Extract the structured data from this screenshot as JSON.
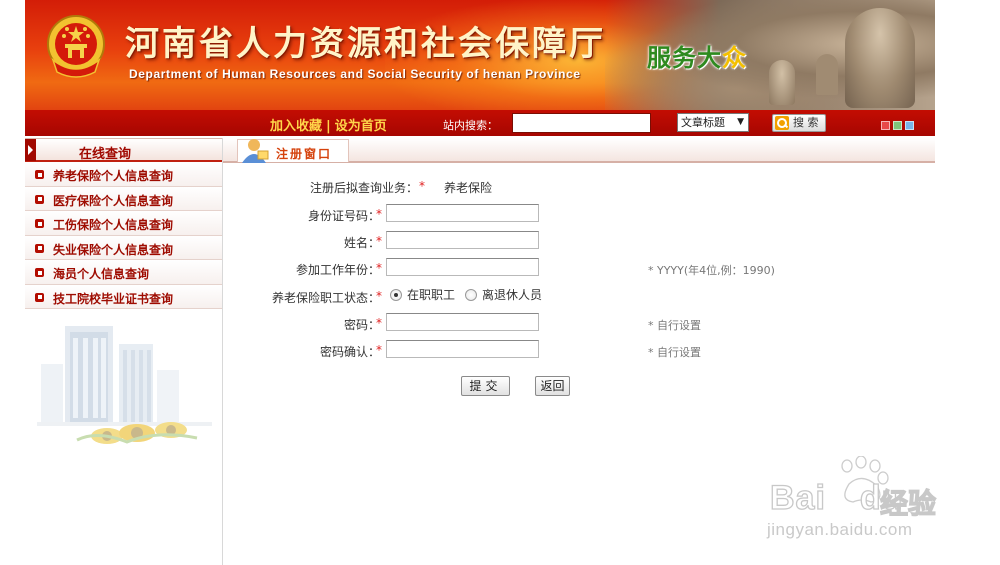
{
  "header": {
    "title": "河南省人力资源和社会保障厅",
    "subtitle": "Department of Human Resources and Social Security of henan Province",
    "slogan_main": "服务大",
    "slogan_last": "众"
  },
  "nav": {
    "bookmark": "加入收藏",
    "separator": "|",
    "homepage": "设为首页",
    "search_label": "站内搜索：",
    "search_value": "",
    "search_type": "文章标题",
    "search_type_arrow": "▼",
    "search_button": "搜 索",
    "swatch_colors": [
      "#e84848",
      "#7fc47a",
      "#7ab4e8"
    ]
  },
  "sidebar": {
    "title": "在线查询",
    "items": [
      {
        "label": "养老保险个人信息查询"
      },
      {
        "label": "医疗保险个人信息查询"
      },
      {
        "label": "工伤保险个人信息查询"
      },
      {
        "label": "失业保险个人信息查询"
      },
      {
        "label": "海员个人信息查询"
      },
      {
        "label": "技工院校毕业证书查询"
      }
    ]
  },
  "panel": {
    "title": "注册窗口"
  },
  "form": {
    "required_mark": "*",
    "business": {
      "label": "注册后拟查询业务：",
      "value": "养老保险"
    },
    "id_number": {
      "label": "身份证号码：",
      "value": ""
    },
    "name": {
      "label": "姓名：",
      "value": ""
    },
    "work_year": {
      "label": "参加工作年份：",
      "value": "",
      "hint": "* YYYY(年4位,例：1990)"
    },
    "status": {
      "label": "养老保险职工状态：",
      "options": [
        {
          "label": "在职职工",
          "checked": true
        },
        {
          "label": "离退休人员",
          "checked": false
        }
      ]
    },
    "password": {
      "label": "密码：",
      "value": "",
      "hint": "* 自行设置"
    },
    "password_confirm": {
      "label": "密码确认：",
      "value": "",
      "hint": "* 自行设置"
    },
    "submit_label": "提交",
    "back_label": "返回"
  },
  "watermark": {
    "logo_text": "Bai",
    "logo_text2": "du",
    "cn_text": "经验",
    "url": "jingyan.baidu.com"
  }
}
